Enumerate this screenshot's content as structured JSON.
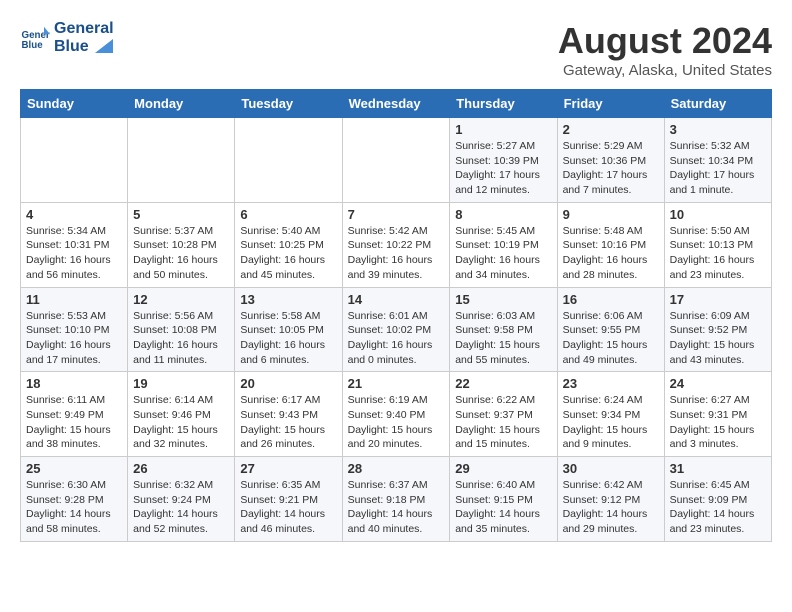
{
  "header": {
    "logo_line1": "General",
    "logo_line2": "Blue",
    "month_year": "August 2024",
    "location": "Gateway, Alaska, United States"
  },
  "days_of_week": [
    "Sunday",
    "Monday",
    "Tuesday",
    "Wednesday",
    "Thursday",
    "Friday",
    "Saturday"
  ],
  "weeks": [
    [
      {
        "day": "",
        "info": ""
      },
      {
        "day": "",
        "info": ""
      },
      {
        "day": "",
        "info": ""
      },
      {
        "day": "",
        "info": ""
      },
      {
        "day": "1",
        "info": "Sunrise: 5:27 AM\nSunset: 10:39 PM\nDaylight: 17 hours\nand 12 minutes."
      },
      {
        "day": "2",
        "info": "Sunrise: 5:29 AM\nSunset: 10:36 PM\nDaylight: 17 hours\nand 7 minutes."
      },
      {
        "day": "3",
        "info": "Sunrise: 5:32 AM\nSunset: 10:34 PM\nDaylight: 17 hours\nand 1 minute."
      }
    ],
    [
      {
        "day": "4",
        "info": "Sunrise: 5:34 AM\nSunset: 10:31 PM\nDaylight: 16 hours\nand 56 minutes."
      },
      {
        "day": "5",
        "info": "Sunrise: 5:37 AM\nSunset: 10:28 PM\nDaylight: 16 hours\nand 50 minutes."
      },
      {
        "day": "6",
        "info": "Sunrise: 5:40 AM\nSunset: 10:25 PM\nDaylight: 16 hours\nand 45 minutes."
      },
      {
        "day": "7",
        "info": "Sunrise: 5:42 AM\nSunset: 10:22 PM\nDaylight: 16 hours\nand 39 minutes."
      },
      {
        "day": "8",
        "info": "Sunrise: 5:45 AM\nSunset: 10:19 PM\nDaylight: 16 hours\nand 34 minutes."
      },
      {
        "day": "9",
        "info": "Sunrise: 5:48 AM\nSunset: 10:16 PM\nDaylight: 16 hours\nand 28 minutes."
      },
      {
        "day": "10",
        "info": "Sunrise: 5:50 AM\nSunset: 10:13 PM\nDaylight: 16 hours\nand 23 minutes."
      }
    ],
    [
      {
        "day": "11",
        "info": "Sunrise: 5:53 AM\nSunset: 10:10 PM\nDaylight: 16 hours\nand 17 minutes."
      },
      {
        "day": "12",
        "info": "Sunrise: 5:56 AM\nSunset: 10:08 PM\nDaylight: 16 hours\nand 11 minutes."
      },
      {
        "day": "13",
        "info": "Sunrise: 5:58 AM\nSunset: 10:05 PM\nDaylight: 16 hours\nand 6 minutes."
      },
      {
        "day": "14",
        "info": "Sunrise: 6:01 AM\nSunset: 10:02 PM\nDaylight: 16 hours\nand 0 minutes."
      },
      {
        "day": "15",
        "info": "Sunrise: 6:03 AM\nSunset: 9:58 PM\nDaylight: 15 hours\nand 55 minutes."
      },
      {
        "day": "16",
        "info": "Sunrise: 6:06 AM\nSunset: 9:55 PM\nDaylight: 15 hours\nand 49 minutes."
      },
      {
        "day": "17",
        "info": "Sunrise: 6:09 AM\nSunset: 9:52 PM\nDaylight: 15 hours\nand 43 minutes."
      }
    ],
    [
      {
        "day": "18",
        "info": "Sunrise: 6:11 AM\nSunset: 9:49 PM\nDaylight: 15 hours\nand 38 minutes."
      },
      {
        "day": "19",
        "info": "Sunrise: 6:14 AM\nSunset: 9:46 PM\nDaylight: 15 hours\nand 32 minutes."
      },
      {
        "day": "20",
        "info": "Sunrise: 6:17 AM\nSunset: 9:43 PM\nDaylight: 15 hours\nand 26 minutes."
      },
      {
        "day": "21",
        "info": "Sunrise: 6:19 AM\nSunset: 9:40 PM\nDaylight: 15 hours\nand 20 minutes."
      },
      {
        "day": "22",
        "info": "Sunrise: 6:22 AM\nSunset: 9:37 PM\nDaylight: 15 hours\nand 15 minutes."
      },
      {
        "day": "23",
        "info": "Sunrise: 6:24 AM\nSunset: 9:34 PM\nDaylight: 15 hours\nand 9 minutes."
      },
      {
        "day": "24",
        "info": "Sunrise: 6:27 AM\nSunset: 9:31 PM\nDaylight: 15 hours\nand 3 minutes."
      }
    ],
    [
      {
        "day": "25",
        "info": "Sunrise: 6:30 AM\nSunset: 9:28 PM\nDaylight: 14 hours\nand 58 minutes."
      },
      {
        "day": "26",
        "info": "Sunrise: 6:32 AM\nSunset: 9:24 PM\nDaylight: 14 hours\nand 52 minutes."
      },
      {
        "day": "27",
        "info": "Sunrise: 6:35 AM\nSunset: 9:21 PM\nDaylight: 14 hours\nand 46 minutes."
      },
      {
        "day": "28",
        "info": "Sunrise: 6:37 AM\nSunset: 9:18 PM\nDaylight: 14 hours\nand 40 minutes."
      },
      {
        "day": "29",
        "info": "Sunrise: 6:40 AM\nSunset: 9:15 PM\nDaylight: 14 hours\nand 35 minutes."
      },
      {
        "day": "30",
        "info": "Sunrise: 6:42 AM\nSunset: 9:12 PM\nDaylight: 14 hours\nand 29 minutes."
      },
      {
        "day": "31",
        "info": "Sunrise: 6:45 AM\nSunset: 9:09 PM\nDaylight: 14 hours\nand 23 minutes."
      }
    ]
  ]
}
